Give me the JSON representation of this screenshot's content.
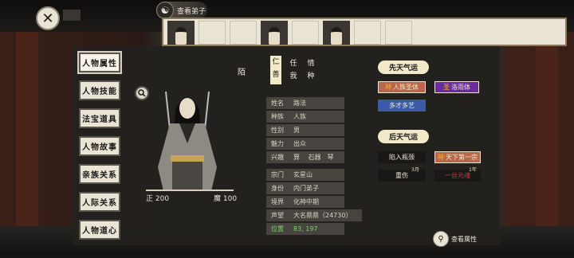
{
  "header": {
    "close_icon": "close-icon",
    "badge": "",
    "title": "查看弟子"
  },
  "roster": {
    "slots": [
      {
        "filled": true
      },
      {
        "filled": false
      },
      {
        "filled": false
      },
      {
        "filled": true
      },
      {
        "filled": false
      },
      {
        "filled": true
      },
      {
        "filled": false
      },
      {
        "filled": false
      }
    ]
  },
  "tabs": [
    "人物属性",
    "人物技能",
    "法宝道具",
    "人物故事",
    "亲族关系",
    "人际关系",
    "人物道心"
  ],
  "character": {
    "name_mark": "陌",
    "alignment_left": "正 200",
    "alignment_right": "魔 100",
    "alignment_fraction": 0.67,
    "traits": [
      [
        "仁",
        "善"
      ],
      [
        "任",
        "我"
      ],
      [
        "情",
        "种"
      ]
    ]
  },
  "info": [
    {
      "key": "姓名",
      "value": "路法"
    },
    {
      "key": "种族",
      "value": "人族"
    },
    {
      "key": "性别",
      "value": "男"
    },
    {
      "key": "魅力",
      "value": "出众"
    },
    {
      "key": "兴趣",
      "value": "算　 石器　琴"
    }
  ],
  "info2": [
    {
      "key": "宗门",
      "value": "玄星山"
    },
    {
      "key": "身份",
      "value": "内门弟子"
    },
    {
      "key": "境界",
      "value": "化神中期"
    },
    {
      "key": "声望",
      "value": "大名鼎鼎（24730）"
    },
    {
      "key": "位置",
      "value": "83, 197"
    }
  ],
  "innate": {
    "title": "先天气运",
    "tags": [
      "人族圣体",
      "洛雨体",
      "多才多艺"
    ]
  },
  "acquired": {
    "title": "后天气运",
    "tags": [
      "陷入瓶颈",
      "天下第一宗",
      "重伤",
      "一丝元魂"
    ],
    "notes": [
      "3月",
      "1年"
    ]
  },
  "inspect_label": "查看属性"
}
